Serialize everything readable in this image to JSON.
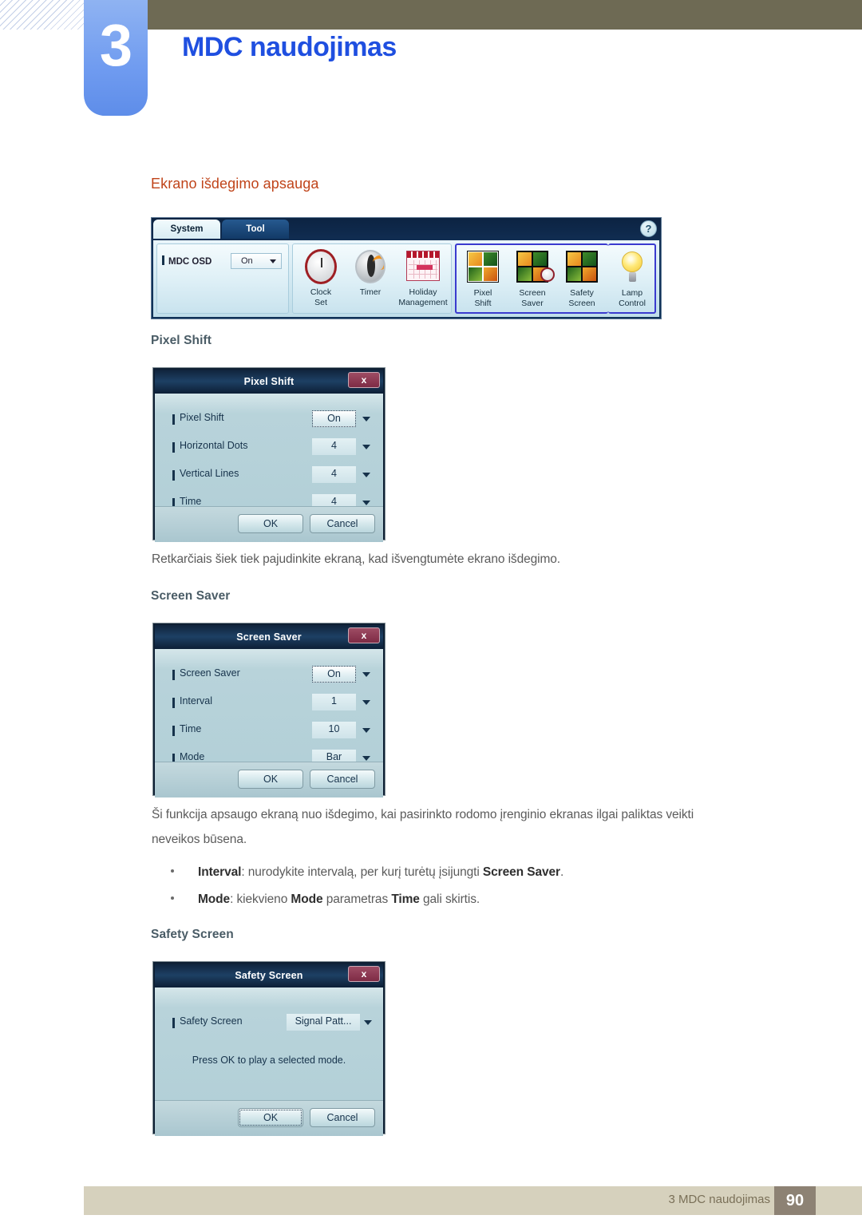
{
  "header": {
    "chapter_number": "3",
    "chapter_title": "MDC naudojimas"
  },
  "section": {
    "title": "Ekrano išdegimo apsauga"
  },
  "toolbar": {
    "tabs": [
      {
        "label": "System",
        "active": true
      },
      {
        "label": "Tool",
        "active": false
      }
    ],
    "help_label": "?",
    "osd": {
      "label": "MDC OSD",
      "value": "On"
    },
    "groups": [
      {
        "name": "time-group",
        "items": [
          {
            "label_line1": "Clock",
            "label_line2": "Set",
            "icon": "clock-icon"
          },
          {
            "label_line1": "Timer",
            "label_line2": "",
            "icon": "timer-icon"
          },
          {
            "label_line1": "Holiday",
            "label_line2": "Management",
            "icon": "calendar-icon"
          }
        ]
      },
      {
        "name": "screen-group",
        "highlighted": true,
        "items": [
          {
            "label_line1": "Pixel",
            "label_line2": "Shift",
            "icon": "photo-tiles-shift-icon"
          },
          {
            "label_line1": "Screen",
            "label_line2": "Saver",
            "icon": "photo-tiles-clock-icon"
          },
          {
            "label_line1": "Safety",
            "label_line2": "Screen",
            "icon": "photo-tiles-icon"
          }
        ]
      },
      {
        "name": "lamp-group",
        "highlighted": true,
        "items": [
          {
            "label_line1": "Lamp",
            "label_line2": "Control",
            "icon": "lightbulb-icon"
          }
        ]
      }
    ]
  },
  "subsections": [
    {
      "heading": "Pixel Shift",
      "dialog": {
        "title": "Pixel Shift",
        "close_label": "x",
        "rows": [
          {
            "label": "Pixel Shift",
            "value": "On",
            "focused": true
          },
          {
            "label": "Horizontal Dots",
            "value": "4",
            "focused": false
          },
          {
            "label": "Vertical Lines",
            "value": "4",
            "focused": false
          },
          {
            "label": "Time",
            "value": "4",
            "focused": false
          }
        ],
        "ok_label": "OK",
        "cancel_label": "Cancel"
      },
      "body": "Retkarčiais šiek tiek pajudinkite ekraną, kad išvengtumėte ekrano išdegimo."
    },
    {
      "heading": "Screen Saver",
      "dialog": {
        "title": "Screen Saver",
        "close_label": "x",
        "rows": [
          {
            "label": "Screen Saver",
            "value": "On",
            "focused": true
          },
          {
            "label": "Interval",
            "value": "1",
            "focused": false
          },
          {
            "label": "Time",
            "value": "10",
            "focused": false
          },
          {
            "label": "Mode",
            "value": "Bar",
            "focused": false
          }
        ],
        "ok_label": "OK",
        "cancel_label": "Cancel"
      },
      "body_line1": "Ši funkcija apsaugo ekraną nuo išdegimo, kai pasirinkto rodomo įrenginio ekranas ilgai paliktas veikti",
      "body_line2": "neveikos būsena.",
      "bullets": [
        {
          "parts": [
            {
              "text": "Interval",
              "bold": true
            },
            {
              "text": ": nurodykite intervalą, per kurį turėtų įsijungti ",
              "bold": false
            },
            {
              "text": "Screen Saver",
              "bold": true
            },
            {
              "text": ".",
              "bold": false
            }
          ]
        },
        {
          "parts": [
            {
              "text": "Mode",
              "bold": true
            },
            {
              "text": ": kiekvieno ",
              "bold": false
            },
            {
              "text": "Mode",
              "bold": true
            },
            {
              "text": " parametras ",
              "bold": false
            },
            {
              "text": "Time",
              "bold": true
            },
            {
              "text": " gali skirtis.",
              "bold": false
            }
          ]
        }
      ]
    },
    {
      "heading": "Safety Screen",
      "dialog": {
        "title": "Safety Screen",
        "close_label": "x",
        "rows": [
          {
            "label": "Safety Screen",
            "value": "Signal Patt...",
            "focused": false
          }
        ],
        "note": "Press OK to play a selected mode.",
        "ok_label": "OK",
        "cancel_label": "Cancel"
      }
    }
  ],
  "footer": {
    "text": "3 MDC naudojimas",
    "page_number": "90"
  },
  "colors": {
    "chapter_tab": "#6f9bf0",
    "chapter_title": "#1f4fe0",
    "header_bar": "#6e6a54",
    "section_title": "#c0441a",
    "subheading": "#4a5c66",
    "body_text": "#5b5b5b",
    "footer_bar": "#d6d1bd",
    "page_box": "#8d8274",
    "dialog_highlight": "#3b3bcf"
  }
}
